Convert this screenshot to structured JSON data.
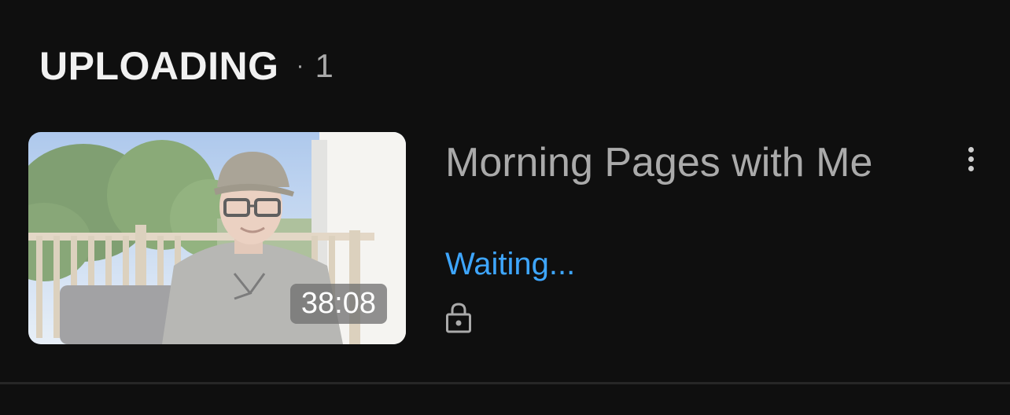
{
  "section": {
    "title": "UPLOADING",
    "separator": "·",
    "count": "1"
  },
  "upload_item": {
    "title": "Morning Pages with Me",
    "status": "Waiting...",
    "duration": "38:08",
    "visibility_icon": "lock-icon",
    "menu_icon": "more-vert-icon"
  },
  "colors": {
    "background": "#0f0f0f",
    "status_blue": "#3ea6ff",
    "title_gray": "#aaaaaa",
    "divider": "#272727"
  }
}
